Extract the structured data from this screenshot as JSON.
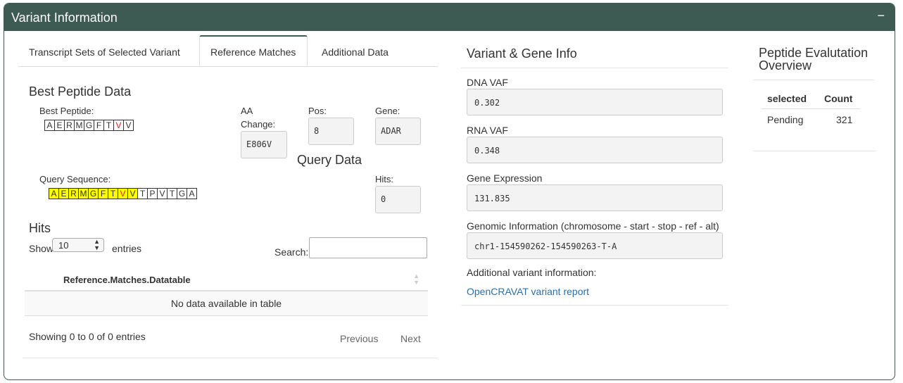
{
  "header": {
    "title": "Variant Information",
    "collapse_icon": "minus-icon",
    "collapse_label": "−"
  },
  "tabs": [
    {
      "label": "Transcript Sets of Selected Variant",
      "active": false
    },
    {
      "label": "Reference Matches",
      "active": true
    },
    {
      "label": "Additional Data",
      "active": false
    }
  ],
  "best_peptide": {
    "section_title": "Best Peptide Data",
    "label": "Best Peptide:",
    "residues": [
      "A",
      "E",
      "R",
      "M",
      "G",
      "F",
      "T",
      "V",
      "V"
    ],
    "mutated_index": 7,
    "aa_change_label_line1": "AA",
    "aa_change_label_line2": "Change:",
    "aa_change_value": "E806V",
    "pos_label": "Pos:",
    "pos_value": "8",
    "gene_label": "Gene:",
    "gene_value": "ADAR"
  },
  "query": {
    "section_title": "Query Data",
    "label": "Query Sequence:",
    "residues": [
      "A",
      "E",
      "R",
      "M",
      "G",
      "F",
      "T",
      "V",
      "V",
      "T",
      "P",
      "V",
      "T",
      "G",
      "A"
    ],
    "highlight_count": 9,
    "mutated_index": 7,
    "hits_label": "Hits:",
    "hits_value": "0"
  },
  "hits_table": {
    "section_title": "Hits",
    "show_label": "Show",
    "entries_label": "entries",
    "page_length": "10",
    "search_label": "Search:",
    "search_value": "",
    "column_header": "Reference.Matches.Datatable",
    "empty_message": "No data available in table",
    "info": "Showing 0 to 0 of 0 entries",
    "previous_label": "Previous",
    "next_label": "Next"
  },
  "variant_gene_info": {
    "title": "Variant & Gene Info",
    "dna_vaf_label": "DNA VAF",
    "dna_vaf_value": "0.302",
    "rna_vaf_label": "RNA VAF",
    "rna_vaf_value": "0.348",
    "gene_expression_label": "Gene Expression",
    "gene_expression_value": "131.835",
    "genomic_info_label": "Genomic Information (chromosome - start - stop - ref - alt)",
    "genomic_info_value": "chr1-154590262-154590263-T-A",
    "additional_label": "Additional variant information:",
    "opencravat_link": "OpenCRAVAT variant report"
  },
  "peptide_overview": {
    "title_line1": "Peptide Evalutation",
    "title_line2": "Overview",
    "columns": [
      "selected",
      "Count"
    ],
    "rows": [
      {
        "selected": "Pending",
        "count": "321"
      }
    ]
  },
  "colors": {
    "header_bg": "#3e5b53",
    "highlight": "#ffff00",
    "mutation": "#e02020",
    "link": "#2a6fa8"
  }
}
